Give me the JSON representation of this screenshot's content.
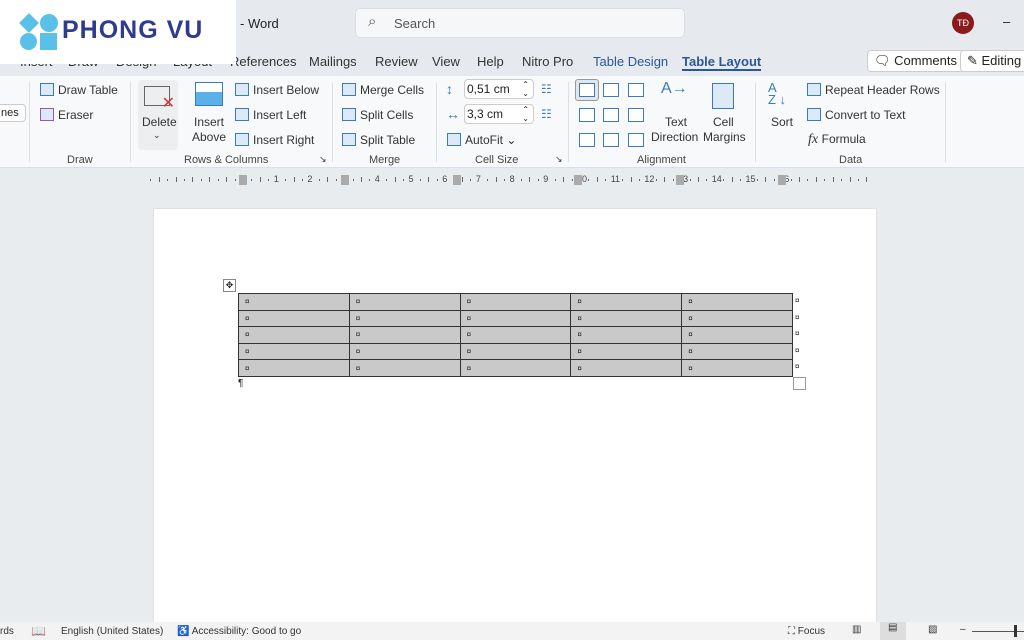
{
  "app": {
    "title_suffix": "- Word",
    "search_placeholder": "Search",
    "avatar": "TĐ",
    "minimize": "–"
  },
  "watermark": {
    "text": "PHONG VU"
  },
  "tabs": [
    {
      "label": "Insert"
    },
    {
      "label": "Draw"
    },
    {
      "label": "Design"
    },
    {
      "label": "Layout"
    },
    {
      "label": "References"
    },
    {
      "label": "Mailings"
    },
    {
      "label": "Review"
    },
    {
      "label": "View"
    },
    {
      "label": "Help"
    },
    {
      "label": "Nitro Pro"
    },
    {
      "label": "Table Design"
    },
    {
      "label": "Table Layout"
    }
  ],
  "header_buttons": {
    "comments": "Comments",
    "editing": "Editing"
  },
  "ribbon": {
    "left_cut": "nes",
    "draw": {
      "draw_table": "Draw Table",
      "eraser": "Eraser",
      "group": "Draw"
    },
    "rows_columns": {
      "delete": "Delete",
      "insert_above_1": "Insert",
      "insert_above_2": "Above",
      "insert_below": "Insert Below",
      "insert_left": "Insert Left",
      "insert_right": "Insert Right",
      "group": "Rows & Columns"
    },
    "merge": {
      "merge_cells": "Merge Cells",
      "split_cells": "Split Cells",
      "split_table": "Split Table",
      "group": "Merge"
    },
    "cell_size": {
      "height": "0,51 cm",
      "width": "3,3 cm",
      "autofit": "AutoFit",
      "group": "Cell Size"
    },
    "alignment": {
      "text_direction_1": "Text",
      "text_direction_2": "Direction",
      "cell_margins_1": "Cell",
      "cell_margins_2": "Margins",
      "group": "Alignment"
    },
    "data": {
      "sort": "Sort",
      "repeat_header": "Repeat Header Rows",
      "convert": "Convert to Text",
      "formula": "Formula",
      "group": "Data"
    }
  },
  "ruler": {
    "numbers": [
      "1",
      "2",
      "3",
      "4",
      "5",
      "6",
      "7",
      "8",
      "9",
      "10",
      "11",
      "12",
      "13",
      "14",
      "15",
      "16"
    ]
  },
  "document": {
    "table": {
      "rows": 5,
      "cols": 5,
      "cell_mark": "¤",
      "fill": "#c9c9c9"
    },
    "paragraph_mark": "¶"
  },
  "status": {
    "words": "rds",
    "language": "English (United States)",
    "accessibility": "Accessibility: Good to go",
    "focus": "Focus"
  },
  "colors": {
    "accent": "#2b579a",
    "avatar": "#8b1a1a",
    "watermark": "#2e3b8f"
  }
}
